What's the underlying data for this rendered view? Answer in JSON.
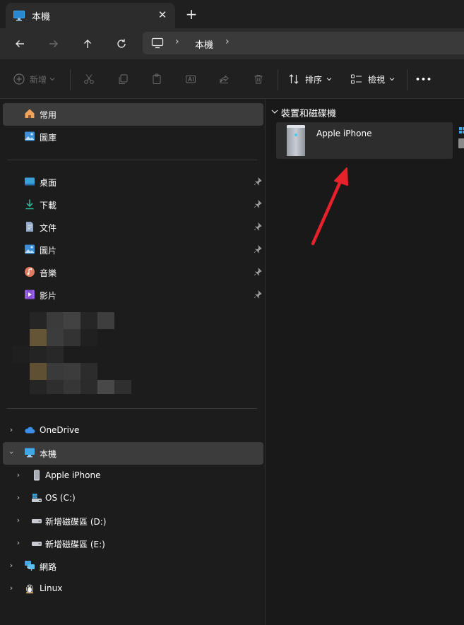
{
  "window": {
    "tab_title": "本機",
    "tab_close": "✕",
    "new_tab": "+"
  },
  "nav": {
    "breadcrumb": "本機",
    "separator": "›"
  },
  "toolbar": {
    "new_label": "新增",
    "sort_label": "排序",
    "view_label": "檢視",
    "more_label": "•••"
  },
  "sidebar": {
    "quick": [
      {
        "label": "常用",
        "icon": "home-icon"
      },
      {
        "label": "圖庫",
        "icon": "gallery-icon"
      }
    ],
    "pinned": [
      {
        "label": "桌面",
        "icon": "desktop-icon"
      },
      {
        "label": "下載",
        "icon": "download-icon"
      },
      {
        "label": "文件",
        "icon": "document-icon"
      },
      {
        "label": "圖片",
        "icon": "pictures-icon"
      },
      {
        "label": "音樂",
        "icon": "music-icon"
      },
      {
        "label": "影片",
        "icon": "video-icon"
      }
    ],
    "tree": [
      {
        "label": "OneDrive",
        "icon": "cloud-icon"
      },
      {
        "label": "本機",
        "icon": "computer-icon"
      },
      {
        "label": "Apple iPhone",
        "icon": "phone-icon"
      },
      {
        "label": "OS (C:)",
        "icon": "os-drive-icon"
      },
      {
        "label": "新增磁碟區 (D:)",
        "icon": "drive-icon"
      },
      {
        "label": "新增磁碟區 (E:)",
        "icon": "drive-icon"
      },
      {
        "label": "網路",
        "icon": "network-icon"
      },
      {
        "label": "Linux",
        "icon": "linux-icon"
      }
    ]
  },
  "main": {
    "group_title": "裝置和磁碟機",
    "items": [
      {
        "name": "Apple iPhone",
        "icon": "phone-device-icon"
      }
    ]
  },
  "colors": {
    "accent_arrow": "#e8212b",
    "selected_row": "#3c3c3c",
    "tile_bg": "#2d2d2d"
  }
}
